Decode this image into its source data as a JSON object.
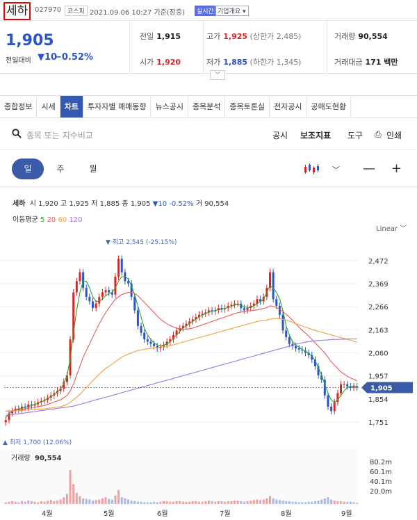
{
  "header": {
    "name": "세하",
    "code": "027970",
    "market": "코스피",
    "datetime": "2021.09.06 10:27 기준(장중)",
    "realtime": "실시간",
    "overview": "기업개요 ▾"
  },
  "quote": {
    "price": "1,905",
    "change_label": "전일대비",
    "change": "▼10",
    "change_pct": "−0.52%",
    "prev_label": "전일",
    "prev": "1,915",
    "open_label": "시가",
    "open": "1,920",
    "high_label": "고가",
    "high": "1,925",
    "upper_limit": "(상한가 2,485)",
    "low_label": "저가",
    "low": "1,885",
    "lower_limit": "(하한가 1,345)",
    "volume_label": "거래량",
    "volume": "90,554",
    "amount_label": "거래대금",
    "amount": "171 백만"
  },
  "tabs": [
    "종합정보",
    "시세",
    "차트",
    "투자자별 매매동향",
    "뉴스공시",
    "종목분석",
    "종목토론실",
    "전자공시",
    "공매도현황"
  ],
  "search": {
    "placeholder": "종목 또는 지수비교",
    "disclosure": "공시",
    "indicator": "보조지표",
    "tools": "도구",
    "print": "인쇄"
  },
  "periods": [
    "일",
    "주",
    "월"
  ],
  "summary": {
    "name": "세하",
    "open_label": "시",
    "open": "1,920",
    "high_label": "고",
    "high": "1,925",
    "low_label": "저",
    "low": "1,885",
    "close_label": "종",
    "close": "1,905",
    "change": "▼10",
    "pct": "-0.52%",
    "vol_label": "거",
    "vol": "90,554"
  },
  "ma": {
    "label": "이동평균",
    "p5": "5",
    "p20": "20",
    "p60": "60",
    "p120": "120"
  },
  "scale": "Linear",
  "chart_data": {
    "type": "candlestick",
    "y_ticks": [
      2472,
      2369,
      2266,
      2163,
      2060,
      1957,
      1854,
      1751
    ],
    "y_tick_labels": [
      "2,472",
      "2,369",
      "2,266",
      "2,163",
      "2,060",
      "1,957",
      "1,854",
      "1,751"
    ],
    "x_labels": [
      "4월",
      "5월",
      "6월",
      "7월",
      "8월",
      "9월"
    ],
    "ylim": [
      1680,
      2580
    ],
    "current": "1,905",
    "high_label": "최고 2,545 (-25.15%)",
    "low_label": "최저 1,700 (12.06%)",
    "volume_label": "거래량",
    "volume_value": "90,554",
    "vol_ticks": [
      "80.2m",
      "60.1m",
      "40.1m",
      "20.0m"
    ],
    "close": [
      1760,
      1790,
      1800,
      1810,
      1805,
      1820,
      1815,
      1830,
      1825,
      1830,
      1840,
      1845,
      1850,
      1860,
      1870,
      1880,
      1890,
      1900,
      1930,
      1960,
      2120,
      2330,
      2380,
      2420,
      2350,
      2310,
      2290,
      2260,
      2280,
      2310,
      2330,
      2340,
      2330,
      2320,
      2400,
      2480,
      2420,
      2380,
      2370,
      2310,
      2250,
      2180,
      2150,
      2120,
      2110,
      2100,
      2090,
      2080,
      2085,
      2095,
      2110,
      2120,
      2140,
      2160,
      2170,
      2180,
      2190,
      2200,
      2210,
      2220,
      2230,
      2235,
      2240,
      2250,
      2245,
      2250,
      2260,
      2255,
      2260,
      2270,
      2275,
      2280,
      2280,
      2260,
      2250,
      2260,
      2270,
      2280,
      2300,
      2290,
      2310,
      2350,
      2420,
      2300,
      2270,
      2230,
      2160,
      2130,
      2100,
      2090,
      2080,
      2075,
      2070,
      2060,
      2050,
      2030,
      2000,
      1960,
      1940,
      1870,
      1820,
      1800,
      1840,
      1880,
      1920,
      1920,
      1910,
      1905,
      1910,
      1905
    ],
    "ma5": [
      1770,
      1790,
      1800,
      1805,
      1810,
      1812,
      1818,
      1820,
      1825,
      1830,
      1835,
      1840,
      1848,
      1855,
      1865,
      1875,
      1885,
      1900,
      1920,
      1960,
      2030,
      2150,
      2250,
      2330,
      2380,
      2380,
      2350,
      2310,
      2290,
      2290,
      2300,
      2315,
      2325,
      2330,
      2350,
      2380,
      2400,
      2400,
      2390,
      2360,
      2320,
      2270,
      2220,
      2170,
      2140,
      2120,
      2105,
      2095,
      2090,
      2095,
      2100,
      2110,
      2125,
      2140,
      2155,
      2170,
      2180,
      2190,
      2200,
      2210,
      2220,
      2228,
      2235,
      2242,
      2246,
      2249,
      2252,
      2255,
      2258,
      2263,
      2268,
      2273,
      2276,
      2272,
      2266,
      2262,
      2264,
      2270,
      2280,
      2288,
      2300,
      2330,
      2360,
      2350,
      2330,
      2300,
      2250,
      2180,
      2140,
      2110,
      2095,
      2085,
      2075,
      2068,
      2058,
      2045,
      2025,
      1995,
      1960,
      1920,
      1880,
      1850,
      1840,
      1850,
      1870,
      1890,
      1905,
      1910,
      1912,
      1910
    ],
    "ma20": [
      1800,
      1800,
      1802,
      1805,
      1806,
      1808,
      1810,
      1812,
      1815,
      1818,
      1820,
      1822,
      1825,
      1830,
      1835,
      1840,
      1845,
      1850,
      1860,
      1870,
      1890,
      1920,
      1960,
      2000,
      2040,
      2070,
      2100,
      2130,
      2160,
      2190,
      2215,
      2240,
      2260,
      2280,
      2300,
      2310,
      2320,
      2325,
      2330,
      2330,
      2325,
      2315,
      2300,
      2285,
      2270,
      2255,
      2240,
      2225,
      2210,
      2200,
      2190,
      2182,
      2175,
      2170,
      2168,
      2166,
      2166,
      2168,
      2170,
      2175,
      2180,
      2185,
      2190,
      2195,
      2200,
      2205,
      2210,
      2215,
      2220,
      2225,
      2230,
      2235,
      2240,
      2242,
      2244,
      2246,
      2248,
      2250,
      2252,
      2255,
      2258,
      2262,
      2270,
      2268,
      2262,
      2255,
      2245,
      2232,
      2220,
      2205,
      2190,
      2175,
      2160,
      2148,
      2135,
      2120,
      2105,
      2090,
      2075,
      2060,
      2040,
      2020,
      2005,
      1990,
      1975,
      1965,
      1955,
      1948,
      1942,
      1935
    ],
    "ma60": [
      1800,
      1800,
      1800,
      1801,
      1802,
      1803,
      1804,
      1805,
      1806,
      1807,
      1808,
      1809,
      1810,
      1812,
      1814,
      1816,
      1818,
      1820,
      1825,
      1830,
      1838,
      1850,
      1862,
      1875,
      1890,
      1905,
      1920,
      1935,
      1950,
      1965,
      1978,
      1990,
      2000,
      2010,
      2020,
      2030,
      2040,
      2048,
      2055,
      2060,
      2065,
      2070,
      2073,
      2076,
      2078,
      2080,
      2082,
      2084,
      2086,
      2088,
      2090,
      2093,
      2096,
      2100,
      2104,
      2108,
      2112,
      2116,
      2120,
      2124,
      2128,
      2132,
      2136,
      2140,
      2144,
      2148,
      2152,
      2156,
      2160,
      2164,
      2168,
      2172,
      2176,
      2180,
      2184,
      2188,
      2192,
      2196,
      2200,
      2202,
      2204,
      2207,
      2210,
      2212,
      2214,
      2212,
      2210,
      2206,
      2202,
      2196,
      2190,
      2185,
      2180,
      2175,
      2170,
      2165,
      2160,
      2156,
      2152,
      2148,
      2144,
      2140,
      2136,
      2132,
      2128,
      2124,
      2120,
      2116,
      2112,
      2108
    ],
    "ma120": [
      1780,
      1782,
      1784,
      1786,
      1788,
      1790,
      1792,
      1794,
      1796,
      1798,
      1800,
      1802,
      1804,
      1806,
      1808,
      1810,
      1812,
      1814,
      1816,
      1818,
      1820,
      1822,
      1826,
      1830,
      1834,
      1838,
      1842,
      1846,
      1850,
      1854,
      1858,
      1862,
      1866,
      1870,
      1874,
      1878,
      1882,
      1886,
      1890,
      1894,
      1898,
      1902,
      1906,
      1910,
      1914,
      1918,
      1922,
      1926,
      1930,
      1934,
      1938,
      1942,
      1946,
      1950,
      1954,
      1958,
      1962,
      1966,
      1970,
      1974,
      1978,
      1982,
      1986,
      1990,
      1994,
      1998,
      2002,
      2006,
      2010,
      2014,
      2018,
      2022,
      2026,
      2030,
      2034,
      2038,
      2042,
      2046,
      2050,
      2054,
      2058,
      2062,
      2066,
      2070,
      2074,
      2078,
      2082,
      2086,
      2090,
      2094,
      2098,
      2102,
      2105,
      2108,
      2110,
      2112,
      2114,
      2115,
      2116,
      2117,
      2118,
      2119,
      2120,
      2120,
      2121,
      2121,
      2122,
      2122,
      2122,
      2122
    ],
    "volume": [
      3,
      4,
      5,
      4,
      3,
      5,
      4,
      6,
      5,
      4,
      3,
      5,
      4,
      6,
      7,
      5,
      6,
      8,
      12,
      18,
      60,
      35,
      20,
      14,
      10,
      9,
      8,
      6,
      7,
      8,
      10,
      12,
      9,
      8,
      15,
      25,
      12,
      10,
      8,
      6,
      5,
      4,
      4,
      3,
      3,
      3,
      4,
      3,
      4,
      5,
      5,
      4,
      4,
      5,
      5,
      4,
      4,
      4,
      5,
      5,
      4,
      4,
      5,
      6,
      5,
      4,
      5,
      5,
      4,
      5,
      5,
      6,
      6,
      5,
      4,
      5,
      6,
      7,
      8,
      7,
      8,
      10,
      14,
      10,
      8,
      7,
      6,
      5,
      5,
      4,
      4,
      3,
      3,
      3,
      4,
      4,
      5,
      6,
      8,
      10,
      12,
      8,
      6,
      5,
      5,
      4,
      4,
      4,
      3,
      2
    ]
  }
}
